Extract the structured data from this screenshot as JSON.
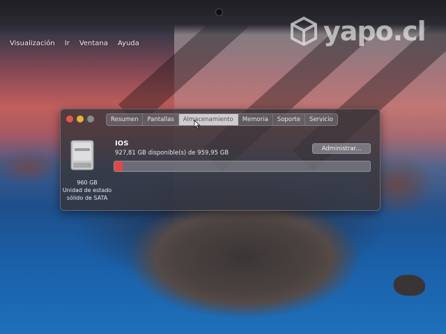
{
  "menubar": {
    "items": [
      "Visualización",
      "Ir",
      "Ventana",
      "Ayuda"
    ]
  },
  "watermark": {
    "text": "yapo.cl",
    "icon": "yapo-cube-logo"
  },
  "window": {
    "tabs": [
      {
        "label": "Resumen",
        "active": false
      },
      {
        "label": "Pantallas",
        "active": false
      },
      {
        "label": "Almacenamiento",
        "active": true
      },
      {
        "label": "Memoria",
        "active": false
      },
      {
        "label": "Soporte",
        "active": false
      },
      {
        "label": "Servicio",
        "active": false
      }
    ],
    "disk": {
      "icon": "hard-drive-icon",
      "capacity": "960 GB",
      "type_line1": "Unidad de estado",
      "type_line2": "sólido de SATA"
    },
    "volume": {
      "name": "IOS",
      "detail": "927,81 GB disponible(s) de 959,95 GB",
      "used_fraction": 0.0335
    },
    "manage_label": "Administrar..."
  },
  "colors": {
    "close": "#e8554c",
    "minimize": "#e4b33c",
    "usage_bar": "#e04848"
  }
}
